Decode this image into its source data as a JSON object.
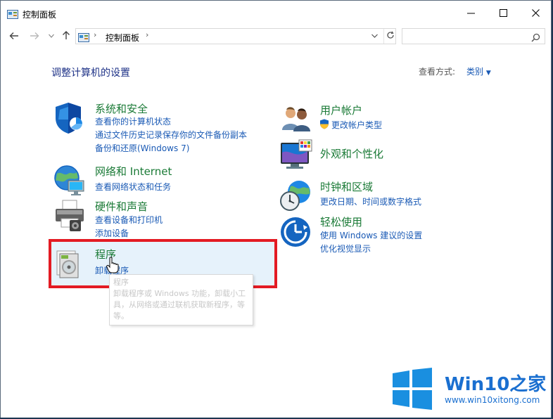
{
  "window": {
    "title": "控制面板",
    "app_icon": "control-panel-icon",
    "controls": {
      "minimize": "minimize-icon",
      "maximize": "maximize-icon",
      "close": "close-icon"
    }
  },
  "address_bar": {
    "breadcrumb": "控制面板",
    "search_placeholder": "",
    "icons": [
      "back-icon",
      "forward-icon",
      "up-icon",
      "refresh-icon",
      "search-icon"
    ]
  },
  "main": {
    "heading": "调整计算机的设置",
    "view_by_label": "查看方式:",
    "view_by_value": "类别",
    "categories": [
      {
        "title": "系统和安全",
        "icon": "shield-icon",
        "links": [
          "查看你的计算机状态",
          "通过文件历史记录保存你的文件备份副本",
          "备份和还原(Windows 7)"
        ]
      },
      {
        "title": "网络和 Internet",
        "icon": "network-icon",
        "links": [
          "查看网络状态和任务"
        ]
      },
      {
        "title": "硬件和声音",
        "icon": "printer-icon",
        "links": [
          "查看设备和打印机",
          "添加设备"
        ]
      },
      {
        "title": "程序",
        "icon": "programs-icon",
        "links": [
          "卸载程序"
        ]
      },
      {
        "title": "用户帐户",
        "icon": "users-icon",
        "links": [
          "更改帐户类型"
        ]
      },
      {
        "title": "外观和个性化",
        "icon": "monitor-icon",
        "links": []
      },
      {
        "title": "时钟和区域",
        "icon": "clock-globe-icon",
        "links": [
          "更改日期、时间或数字格式"
        ]
      },
      {
        "title": "轻松使用",
        "icon": "ease-of-access-icon",
        "links": [
          "使用 Windows 建议的设置",
          "优化视觉显示"
        ]
      }
    ],
    "tooltip": {
      "title": "程序",
      "body": "卸载程序或 Windows 功能，卸载小工具，从网络或通过联机获取新程序，等等。"
    }
  },
  "watermark": {
    "brand": "Win10之家",
    "url": "www.win10xitong.com",
    "colors": {
      "brand": "#1a6fd0"
    }
  },
  "colors": {
    "category_title": "#1a7a36",
    "link": "#1a5ab5",
    "heading": "#1e3287",
    "highlight_frame": "#e31b23",
    "hover_bg": "#e6f2fb"
  }
}
